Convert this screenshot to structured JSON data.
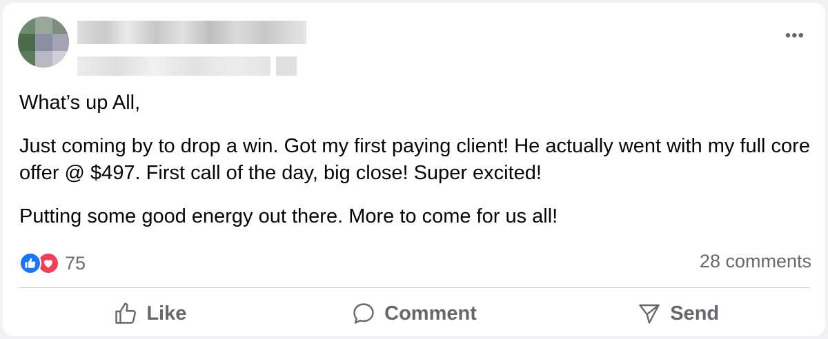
{
  "post": {
    "author_name": "",
    "timestamp": "",
    "more_label": "•••",
    "paragraphs": [
      "What’s up All,",
      "Just coming by to drop a win. Got my first paying client! He actually went with my full core offer @ $497. First call of the day, big close! Super excited!",
      "Putting some good energy out there. More to come for us all!"
    ]
  },
  "reactions": {
    "types": [
      "like",
      "love"
    ],
    "count": "75"
  },
  "comments": {
    "count_label": "28 comments"
  },
  "actions": {
    "like_label": "Like",
    "comment_label": "Comment",
    "send_label": "Send"
  },
  "colors": {
    "like_blue": "#1877f2",
    "love_red": "#f33e58",
    "secondary_text": "#65676b",
    "primary_text": "#050505"
  },
  "icons": [
    "blurred-avatar",
    "more-options-icon",
    "like-reaction-icon",
    "love-reaction-icon",
    "thumbs-up-icon",
    "comment-bubble-icon",
    "send-icon"
  ]
}
